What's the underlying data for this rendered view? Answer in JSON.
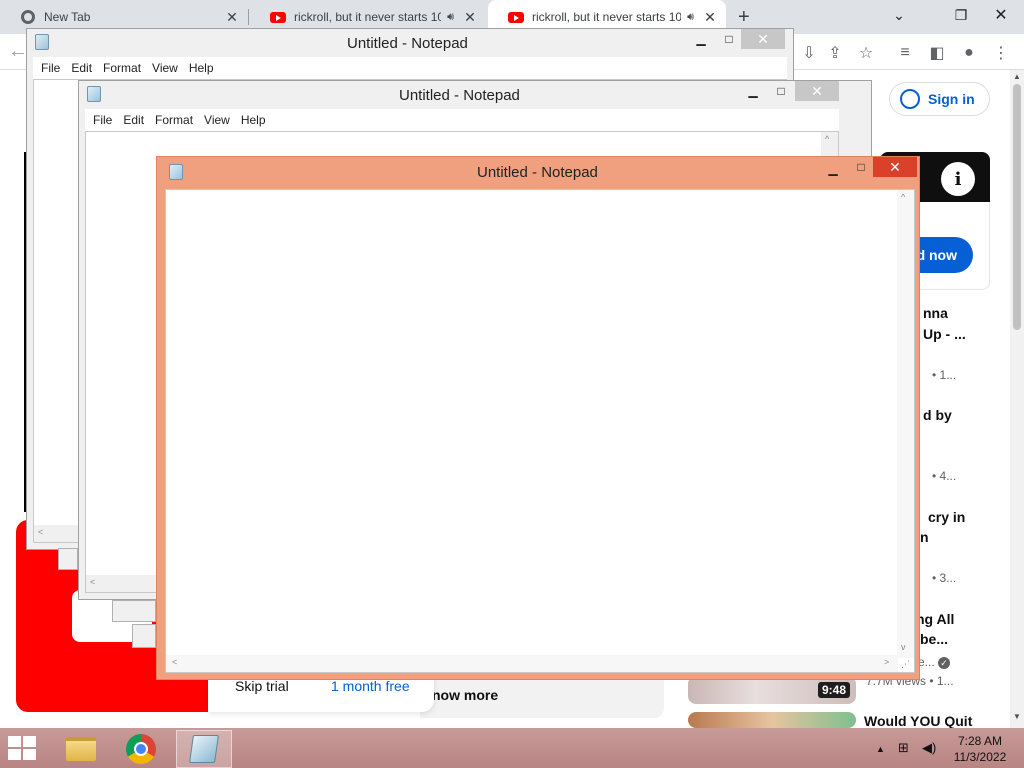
{
  "browser": {
    "tabs": [
      {
        "title": "New Tab",
        "audio": false
      },
      {
        "title": "rickroll, but it never starts 10",
        "audio": true
      },
      {
        "title": "rickroll, but it never starts 10",
        "audio": true
      }
    ]
  },
  "youtube": {
    "signin_label": "Sign in",
    "ad_button_label": "d now",
    "sidebar": [
      {
        "title_lines": [
          "nna",
          "Up - ..."
        ],
        "meta": "• 1..."
      },
      {
        "title_lines": [
          "d by"
        ],
        "meta": "• 4..."
      },
      {
        "title_lines": [
          "cry in",
          "n"
        ],
        "meta": "• 3..."
      },
      {
        "title_lines": [
          "ng All",
          "be..."
        ],
        "meta": "e...",
        "meta2": "7.7M views • 1..."
      },
      {
        "title_lines": [
          "Would YOU Quit"
        ],
        "meta": ""
      }
    ],
    "duration": "9:48",
    "promo": {
      "skip_label": "Skip trial",
      "offer_label": "1 month free"
    },
    "show_more_label": "now more"
  },
  "notepad_windows": [
    {
      "title": "Untitled - Notepad",
      "menu": [
        "File",
        "Edit",
        "Format",
        "View",
        "Help"
      ]
    },
    {
      "title": "Untitled - Notepad",
      "menu": [
        "File",
        "Edit",
        "Format",
        "View",
        "Help"
      ]
    },
    {
      "title": "Untitled - Notepad",
      "menu": []
    }
  ],
  "taskbar": {
    "time": "7:28 AM",
    "date": "11/3/2022"
  },
  "colors": {
    "active_frame": "#f0a07e",
    "taskbar": "#c79a98",
    "youtube_red": "#ff0000",
    "link_blue": "#065fd4"
  }
}
